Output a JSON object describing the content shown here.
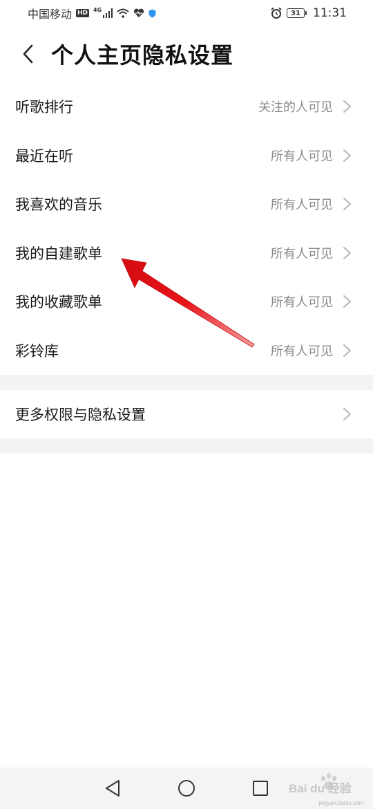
{
  "status_bar": {
    "carrier": "中国移动",
    "hd": "HD",
    "network": "4G",
    "battery": "31",
    "time": "11:31"
  },
  "header": {
    "title": "个人主页隐私设置"
  },
  "settings": {
    "items": [
      {
        "label": "听歌排行",
        "value": "关注的人可见"
      },
      {
        "label": "最近在听",
        "value": "所有人可见"
      },
      {
        "label": "我喜欢的音乐",
        "value": "所有人可见"
      },
      {
        "label": "我的自建歌单",
        "value": "所有人可见"
      },
      {
        "label": "我的收藏歌单",
        "value": "所有人可见"
      },
      {
        "label": "彩铃库",
        "value": "所有人可见"
      }
    ],
    "more": {
      "label": "更多权限与隐私设置"
    }
  },
  "watermark": {
    "logo": "Bai du 经验",
    "url": "jingyan.baidu.com"
  },
  "colors": {
    "annotation_arrow": "#e8141b",
    "secondary_text": "#8a8a8a",
    "section_gap": "#f3f3f3"
  }
}
